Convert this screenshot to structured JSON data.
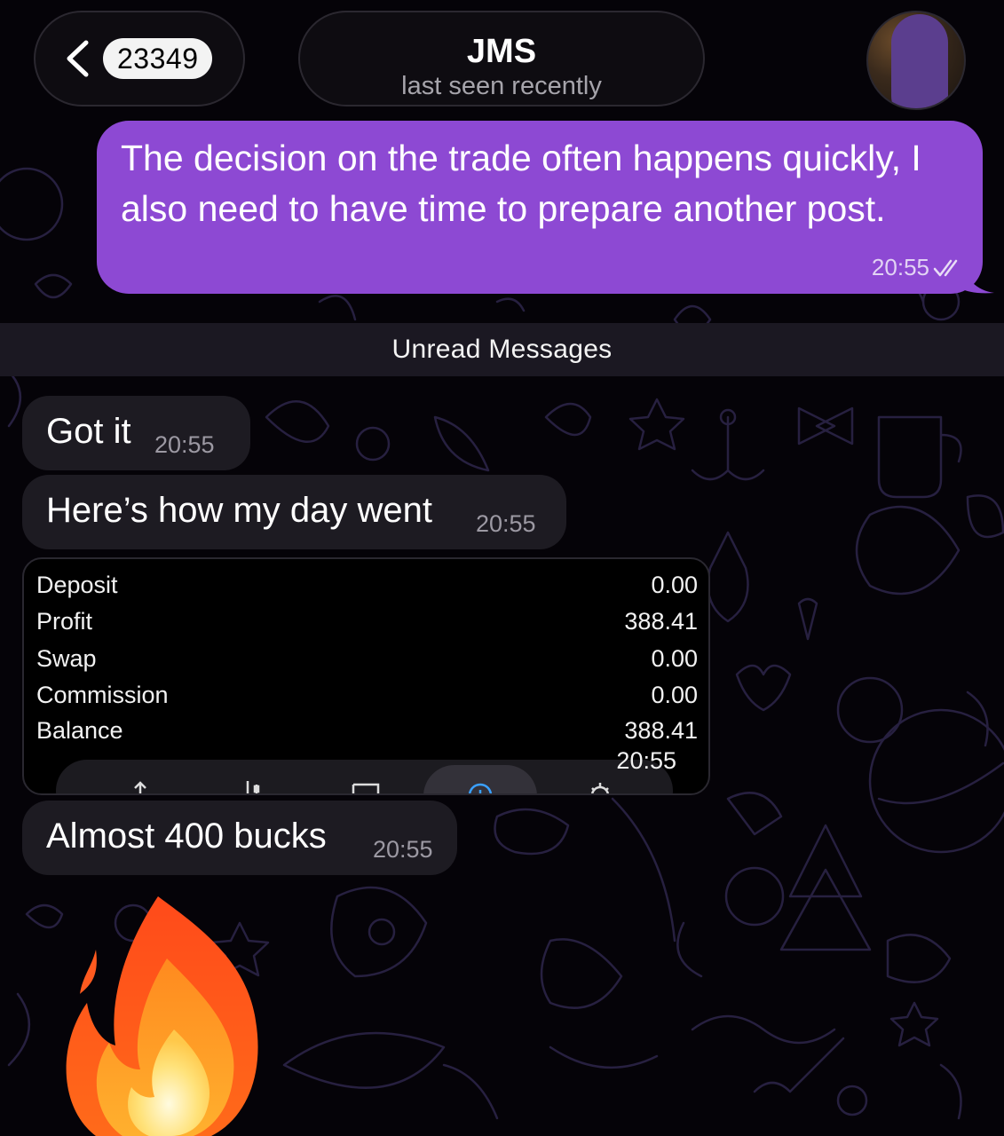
{
  "header": {
    "unread_count": "23349",
    "chat_title": "JMS",
    "chat_status": "last seen recently"
  },
  "messages": {
    "outgoing": {
      "text": "The decision on the trade often happens quickly, I also need to have time to prepare another post.",
      "time": "20:55"
    },
    "unread_separator": "Unread Messages",
    "incoming": [
      {
        "text": "Got it",
        "time": "20:55"
      },
      {
        "text": "Here’s how my day went",
        "time": "20:55"
      },
      {
        "text": "Almost 400 bucks",
        "time": "20:55"
      }
    ]
  },
  "stats_screenshot": {
    "rows": [
      {
        "label": "Deposit",
        "value": "0.00"
      },
      {
        "label": "Profit",
        "value": "388.41"
      },
      {
        "label": "Swap",
        "value": "0.00"
      },
      {
        "label": "Commission",
        "value": "0.00"
      },
      {
        "label": "Balance",
        "value": "388.41"
      }
    ],
    "time": "20:55"
  },
  "emoji": "fire-icon",
  "colors": {
    "outgoing_bubble": "#8d49d3",
    "incoming_bubble": "#1d1b22",
    "background": "#050308",
    "doodle_stroke": "#2a2446"
  }
}
